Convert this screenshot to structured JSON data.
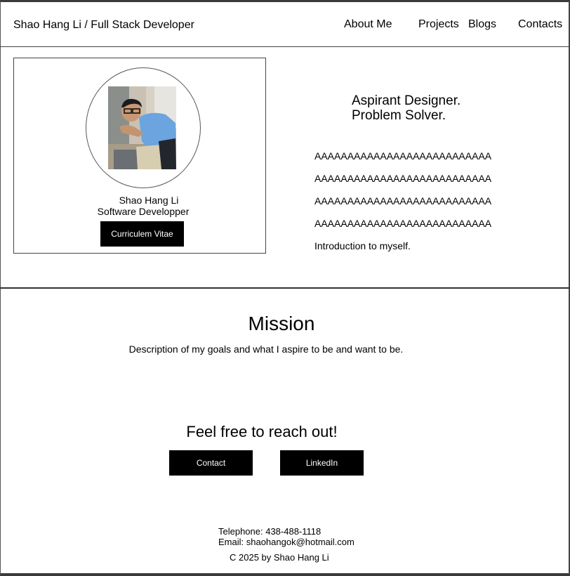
{
  "header": {
    "brand": "Shao Hang Li / Full Stack Developer",
    "nav": [
      "About Me",
      "Projects",
      "Blogs",
      "Contacts"
    ]
  },
  "profile": {
    "name": "Shao Hang Li",
    "role": "Software Developper",
    "cv_button": "Curriculem Vitae"
  },
  "hero": {
    "tagline_1": "Aspirant Designer.",
    "tagline_2": "Problem Solver.",
    "intro_lines": [
      "AAAAAAAAAAAAAAAAAAAAAAAAAAA",
      "AAAAAAAAAAAAAAAAAAAAAAAAAAA",
      "AAAAAAAAAAAAAAAAAAAAAAAAAAA",
      "AAAAAAAAAAAAAAAAAAAAAAAAAAA"
    ],
    "intro_text": "Introduction to myself."
  },
  "mission": {
    "title": "Mission",
    "description": "Description of my goals and what I aspire to be and want to be."
  },
  "reach": {
    "heading": "Feel free to reach out!",
    "contact_button": "Contact",
    "linkedin_button": "LinkedIn"
  },
  "footer": {
    "telephone": "Telephone: 438-488-1118",
    "email": "Email: shaohangok@hotmail.com",
    "copyright": "C 2025 by Shao Hang Li"
  },
  "colors": {
    "background": "#ffffff",
    "button": "#000000",
    "button_text": "#ffffff"
  },
  "icons": {
    "avatar": "profile-photo"
  }
}
